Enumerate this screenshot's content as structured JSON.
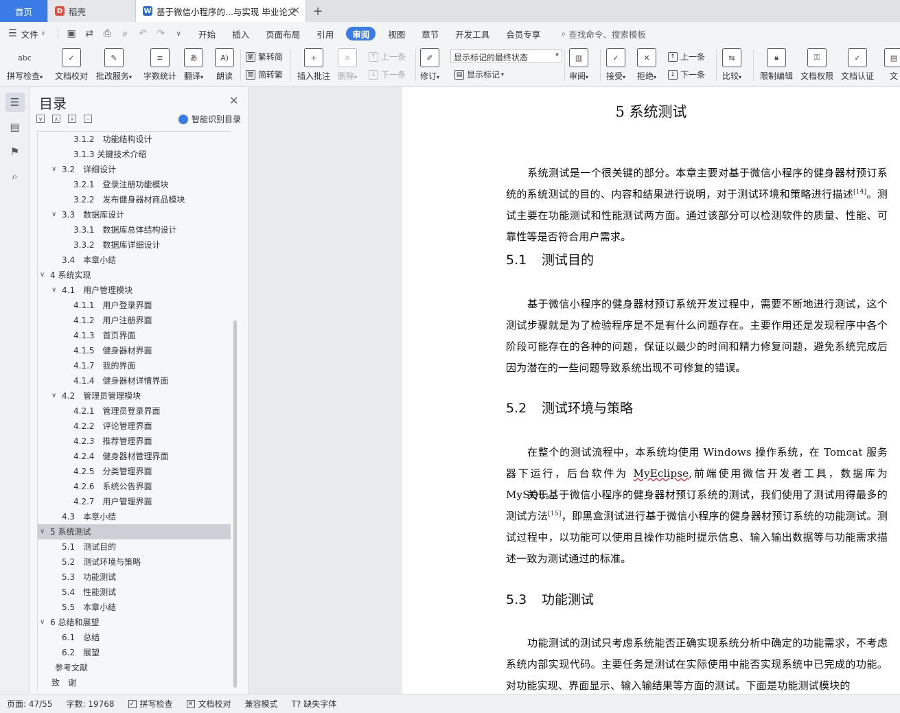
{
  "tabs": {
    "home": "首页",
    "daoke": "稻壳",
    "doc": "基于微信小程序的...与实现 毕业论文"
  },
  "menu": {
    "file": "文件",
    "items": [
      "开始",
      "插入",
      "页面布局",
      "引用",
      "审阅",
      "视图",
      "章节",
      "开发工具",
      "会员专享"
    ],
    "search": "查找命令、搜索模板"
  },
  "ribbon": {
    "spell": "拼写检查",
    "proof": "文档校对",
    "batch": "批改服务",
    "wordcount": "字数统计",
    "translate": "翻译",
    "read": "朗读",
    "trad": "繁转简",
    "simp": "简转繁",
    "insert_comment": "插入批注",
    "delete": "删除",
    "prev": "上一条",
    "next": "下一条",
    "track": "修订",
    "markup_state": "显示标记的最终状态",
    "show_markup": "显示标记",
    "review": "审阅",
    "accept": "接受",
    "reject": "拒绝",
    "prev2": "上一条",
    "next2": "下一条",
    "compare": "比较",
    "restrict": "限制编辑",
    "rights": "文档权限",
    "certify": "文档认证",
    "more": "文"
  },
  "toc": {
    "title": "目录",
    "ai": "智能识别目录",
    "items": [
      {
        "t": "3.1.2　功能结构设计",
        "lvl": 3
      },
      {
        "t": "3.1.3 关键技术介绍",
        "lvl": 3
      },
      {
        "t": "3.2　详细设计",
        "lvl": 2,
        "open": true
      },
      {
        "t": "3.2.1　登录注册功能模块",
        "lvl": 3
      },
      {
        "t": "3.2.2　发布健身器材商品模块",
        "lvl": 3
      },
      {
        "t": "3.3　数据库设计",
        "lvl": 2,
        "open": true
      },
      {
        "t": "3.3.1　数据库总体结构设计",
        "lvl": 3
      },
      {
        "t": "3.3.2　数据库详细设计",
        "lvl": 3
      },
      {
        "t": "3.4　本章小结",
        "lvl": 2
      },
      {
        "t": "4  系统实现",
        "lvl": 1,
        "open": true
      },
      {
        "t": "4.1　用户管理模块",
        "lvl": 2,
        "open": true
      },
      {
        "t": "4.1.1　用户登录界面",
        "lvl": 3
      },
      {
        "t": "4.1.2　用户注册界面",
        "lvl": 3
      },
      {
        "t": "4.1.3　首页界面",
        "lvl": 3
      },
      {
        "t": "4.1.5　健身器材界面",
        "lvl": 3
      },
      {
        "t": "4.1.7　我的界面",
        "lvl": 3
      },
      {
        "t": "4.1.4　健身器材详情界面",
        "lvl": 3
      },
      {
        "t": "4.2　管理员管理模块",
        "lvl": 2,
        "open": true
      },
      {
        "t": "4.2.1　管理员登录界面",
        "lvl": 3
      },
      {
        "t": "4.2.2　评论管理界面",
        "lvl": 3
      },
      {
        "t": "4.2.3　推荐管理界面",
        "lvl": 3
      },
      {
        "t": "4.2.4　健身器材管理界面",
        "lvl": 3
      },
      {
        "t": "4.2.5　分类管理界面",
        "lvl": 3
      },
      {
        "t": "4.2.6　系统公告界面",
        "lvl": 3
      },
      {
        "t": "4.2.7　用户管理界面",
        "lvl": 3
      },
      {
        "t": "4.3　本章小结",
        "lvl": 2
      },
      {
        "t": "5  系统测试",
        "lvl": 1,
        "open": true,
        "sel": true
      },
      {
        "t": "5.1　测试目的",
        "lvl": 2
      },
      {
        "t": "5.2　测试环境与策略",
        "lvl": 2
      },
      {
        "t": "5.3　功能测试",
        "lvl": 2
      },
      {
        "t": "5.4　性能测试",
        "lvl": 2
      },
      {
        "t": "5.5　本章小结",
        "lvl": 2
      },
      {
        "t": "6  总结和展望",
        "lvl": 1,
        "open": true
      },
      {
        "t": "6.1　总结",
        "lvl": 2
      },
      {
        "t": "6.2　展望",
        "lvl": 2
      },
      {
        "t": "参考文献",
        "lvl": 0
      },
      {
        "t": "致　谢",
        "lvl": -1
      }
    ]
  },
  "doc": {
    "chapter": "5  系统测试",
    "intro_a": "系统测试是一个很关键的部分。本章主要对基于微信小程序的健身器材预订系统的系统测试的目的、内容和结果进行说明，对于测试环境和策略进行描述",
    "intro_ref": "[14]",
    "intro_b": "。测试主要在功能测试和性能测试两方面。通过该部分可以检测软件的质量、性能、可靠性等是否符合用户需求。",
    "s51_num": "5.1",
    "s51_title": "测试目的",
    "s51_p": "基于微信小程序的健身器材预订系统开发过程中，需要不断地进行测试，这个测试步骤就是为了检验程序是不是有什么问题存在。主要作用还是发现程序中各个阶段可能存在的各种的问题，保证以最少的时间和精力修复问题，避免系统完成后因为潜在的一些问题导致系统出现不可修复的错误。",
    "s52_num": "5.2",
    "s52_title": "测试环境与策略",
    "s52_p1_a": "在整个的测试流程中，本系统均使用 Windows 操作系统，在 Tomcat 服务器下运行，后台软件为 ",
    "s52_p1_u": "MyEclipse",
    "s52_p1_b": ",前端使用微信开发者工具，数据库为 MySQL。",
    "s52_p2_a": "关于基于微信小程序的健身器材预订系统的测试，我们使用了测试用得最多的测试方法",
    "s52_p2_ref": "[15]",
    "s52_p2_b": "，即黑盒测试进行基于微信小程序的健身器材预订系统的功能测试。测试过程中，以功能可以使用且操作功能时提示信息、输入输出数据等与功能需求描述一致为测试通过的标准。",
    "s53_num": "5.3",
    "s53_title": "功能测试",
    "s53_p": "功能测试的测试只考虑系统能否正确实现系统分析中确定的功能需求，不考虑系统内部实现代码。主要任务是测试在实际使用中能否实现系统中已完成的功能。对功能实现、界面显示、输入输结果等方面的测试。下面是功能测试模块的"
  },
  "status": {
    "page": "页面: 47/55",
    "words": "字数: 19768",
    "spell": "拼写检查",
    "proof": "文档校对",
    "compat": "兼容模式",
    "font": "缺失字体"
  },
  "colors": {
    "accent": "#3a7be8"
  }
}
